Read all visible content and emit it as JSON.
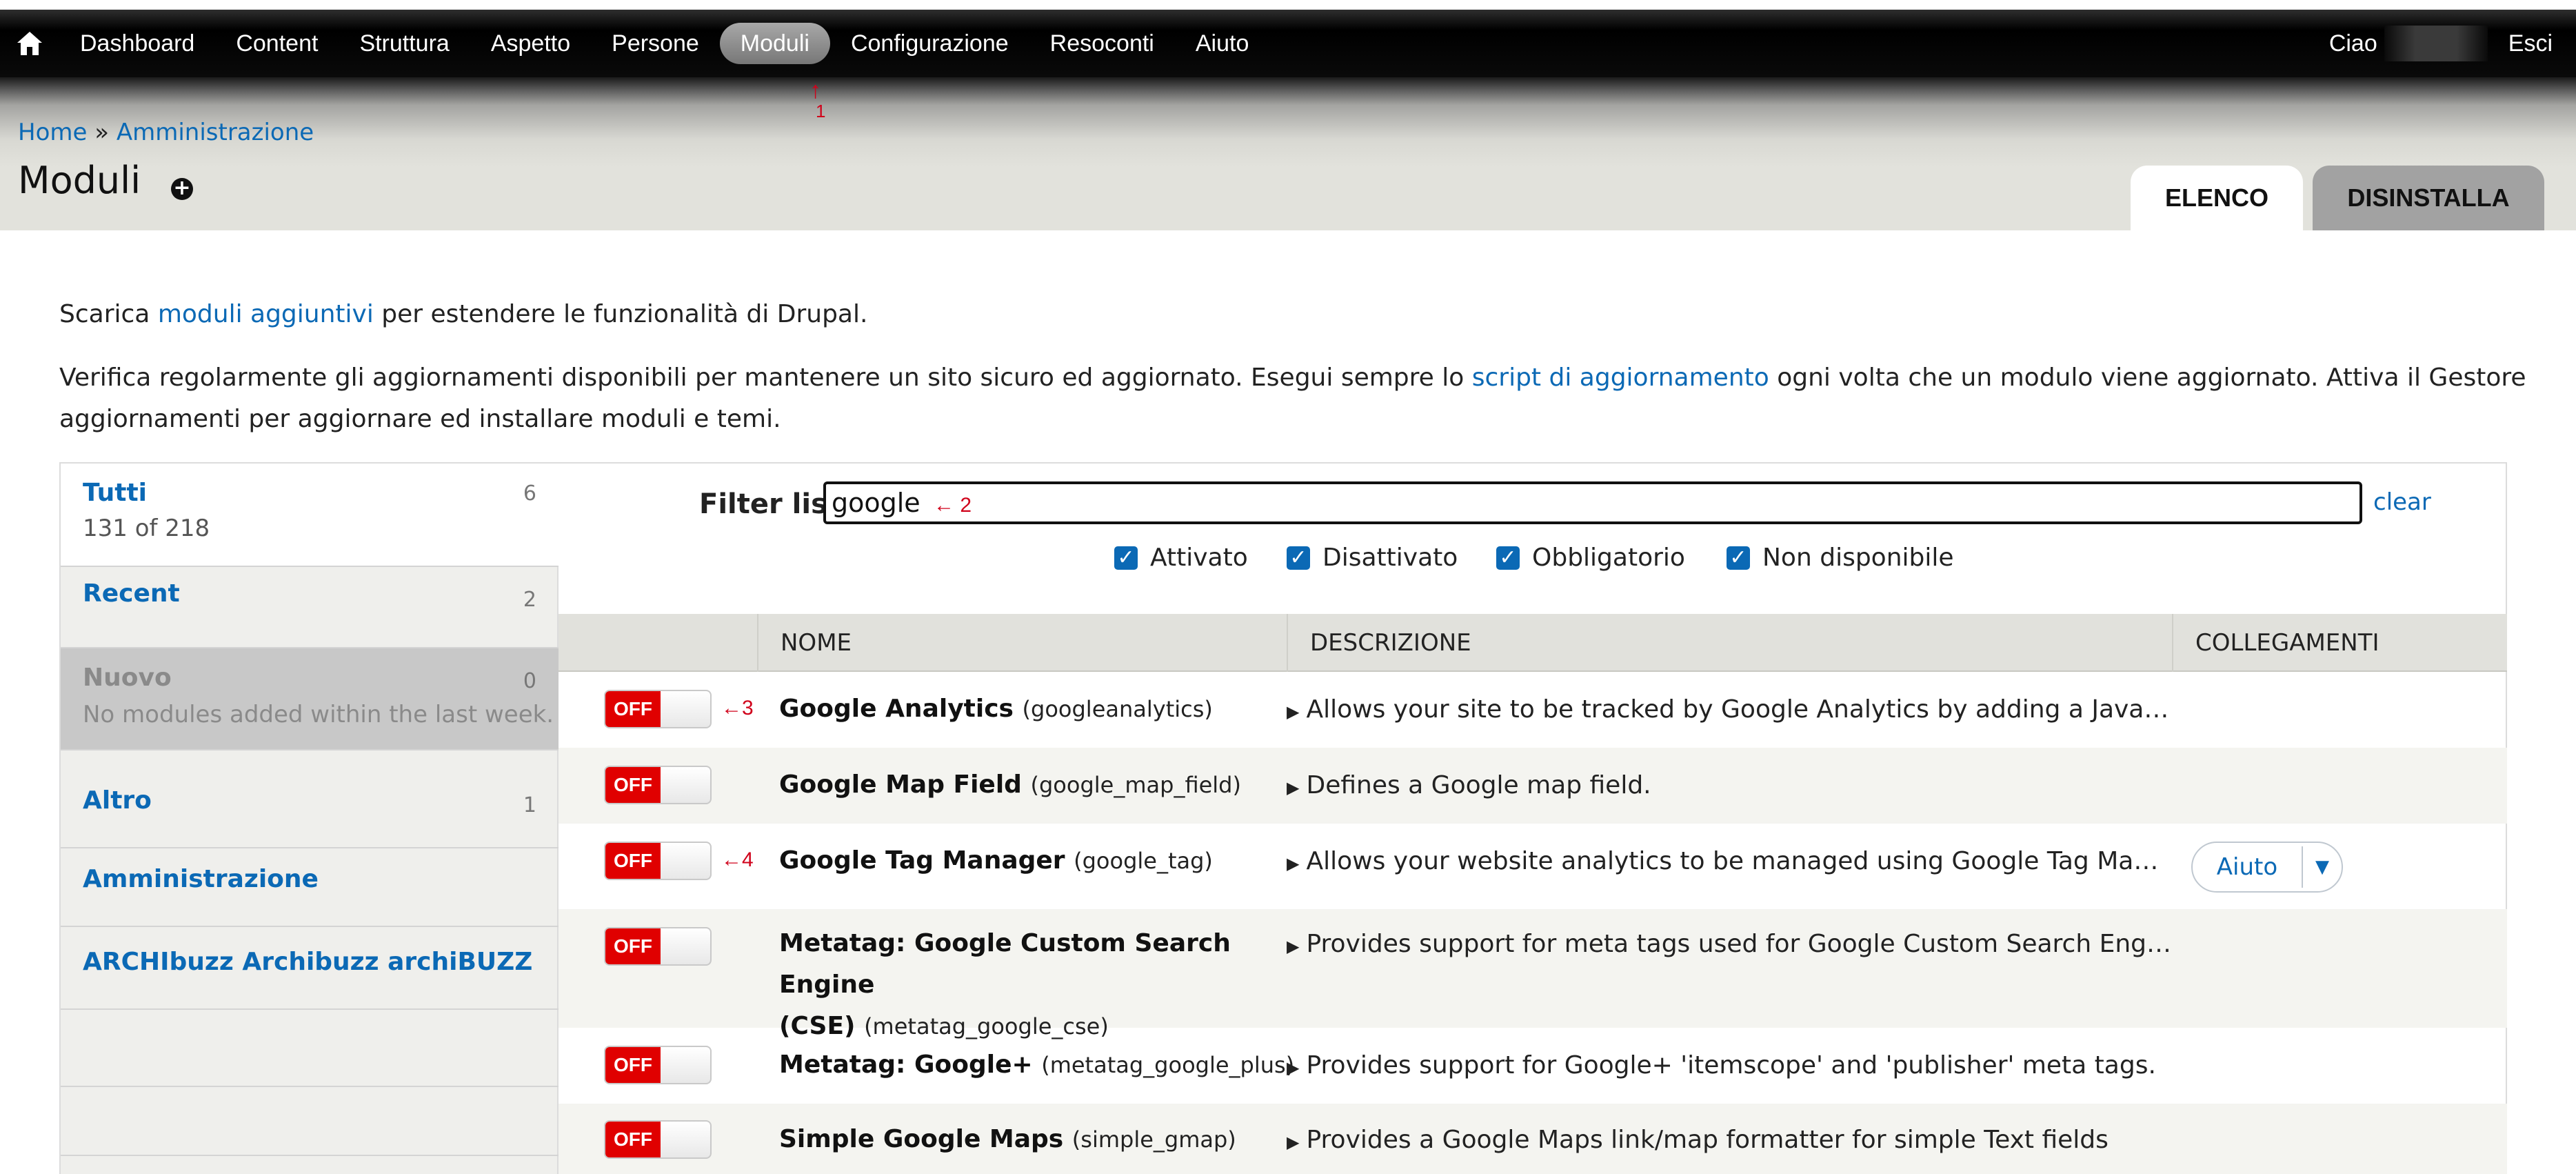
{
  "toolbar": {
    "items": [
      "Dashboard",
      "Content",
      "Struttura",
      "Aspetto",
      "Persone",
      "Moduli",
      "Configurazione",
      "Resoconti",
      "Aiuto"
    ],
    "greeting": "Ciao",
    "logout": "Esci"
  },
  "annotations": {
    "a1": "1",
    "a2": "2",
    "a3": "3",
    "a4": "4"
  },
  "header": {
    "breadcrumb_home": "Home",
    "breadcrumb_sep": "»",
    "breadcrumb_admin": "Amministrazione",
    "title": "Moduli",
    "tabs": [
      "ELENCO",
      "DISINSTALLA"
    ]
  },
  "intro": {
    "line1_pre": "Scarica ",
    "line1_link": "moduli aggiuntivi",
    "line1_post": " per estendere le funzionalità di Drupal.",
    "line2_pre": "Verifica regolarmente gli aggiornamenti disponibili per mantenere un sito sicuro ed aggiornato. Esegui sempre lo ",
    "line2_link": "script di aggiornamento",
    "line2_post": " ogni volta che un modulo viene aggiornato. Attiva il Gestore aggiornamenti per aggiornare ed installare moduli e temi."
  },
  "sidebar": {
    "all": {
      "label": "Tutti",
      "count": "6",
      "sub": "131 of 218"
    },
    "recent": {
      "label": "Recent",
      "count": "2"
    },
    "new": {
      "label": "Nuovo",
      "count": "0",
      "sub": "No modules added within the last week."
    },
    "other": {
      "label": "Altro",
      "count": "1"
    },
    "admin": {
      "label": "Amministrazione"
    },
    "archi": {
      "label": "ARCHIbuzz Archibuzz archiBUZZ"
    }
  },
  "filter": {
    "label": "Filter list",
    "value": "google",
    "clear": "clear",
    "checkboxes": [
      "Attivato",
      "Disattivato",
      "Obbligatorio",
      "Non disponibile"
    ]
  },
  "table": {
    "headers": [
      "NOME",
      "DESCRIZIONE",
      "COLLEGAMENTI"
    ],
    "toggle_label": "OFF",
    "help_label": "Aiuto",
    "rows": [
      {
        "name": "Google Analytics",
        "machine": "(googleanalytics)",
        "desc": "Allows your site to be tracked by Google Analytics by adding a Java…"
      },
      {
        "name": "Google Map Field",
        "machine": "(google_map_field)",
        "desc": "Defines a Google map field."
      },
      {
        "name": "Google Tag Manager",
        "machine": "(google_tag)",
        "desc": "Allows your website analytics to be managed using Google Tag Ma…"
      },
      {
        "name": "Metatag: Google Custom Search Engine",
        "name2": "(CSE)",
        "machine": "(metatag_google_cse)",
        "desc": "Provides support for meta tags used for Google Custom Search Eng…"
      },
      {
        "name": "Metatag: Google+",
        "machine": "(metatag_google_plus)",
        "desc": "Provides support for Google+ 'itemscope' and 'publisher' meta tags."
      },
      {
        "name": "Simple Google Maps",
        "machine": "(simple_gmap)",
        "desc": "Provides a Google Maps link/map formatter for simple Text fields"
      }
    ]
  }
}
